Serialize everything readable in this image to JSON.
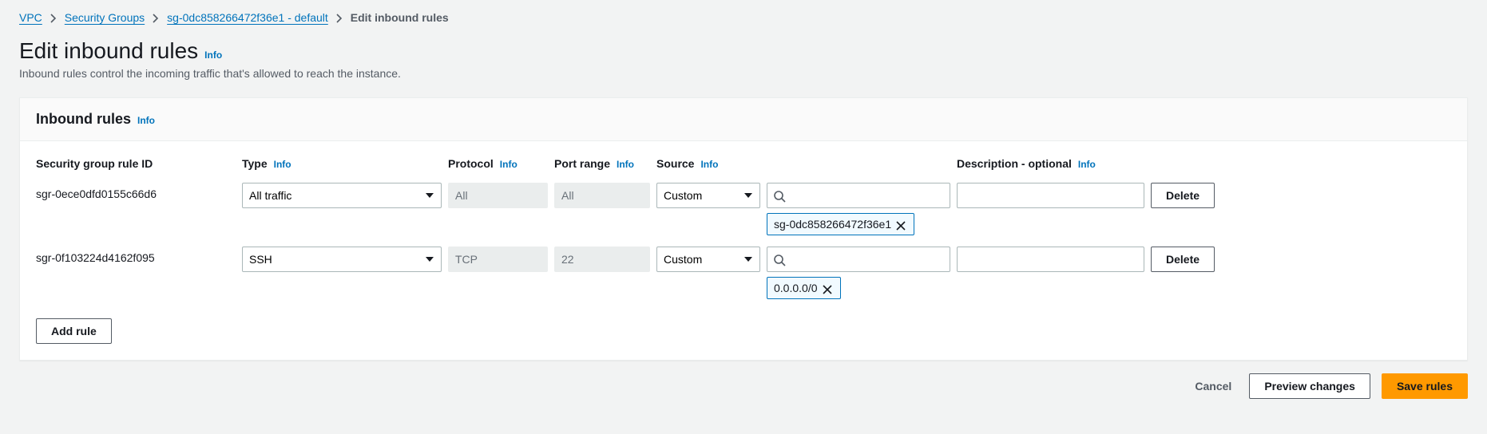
{
  "breadcrumb": {
    "items": [
      {
        "label": "VPC"
      },
      {
        "label": "Security Groups"
      },
      {
        "label": "sg-0dc858266472f36e1 - default"
      }
    ],
    "current": "Edit inbound rules"
  },
  "page": {
    "title": "Edit inbound rules",
    "info": "Info",
    "description": "Inbound rules control the incoming traffic that's allowed to reach the instance."
  },
  "panel": {
    "title": "Inbound rules",
    "info": "Info"
  },
  "columns": {
    "rule_id": "Security group rule ID",
    "type": "Type",
    "protocol": "Protocol",
    "port_range": "Port range",
    "source": "Source",
    "description": "Description - optional",
    "info": "Info"
  },
  "rules": [
    {
      "id": "sgr-0ece0dfd0155c66d6",
      "type": "All traffic",
      "protocol": "All",
      "port_range": "All",
      "source_mode": "Custom",
      "source_search": "",
      "source_tags": [
        "sg-0dc858266472f36e1"
      ],
      "description": ""
    },
    {
      "id": "sgr-0f103224d4162f095",
      "type": "SSH",
      "protocol": "TCP",
      "port_range": "22",
      "source_mode": "Custom",
      "source_search": "",
      "source_tags": [
        "0.0.0.0/0"
      ],
      "description": ""
    }
  ],
  "buttons": {
    "delete": "Delete",
    "add_rule": "Add rule",
    "cancel": "Cancel",
    "preview": "Preview changes",
    "save": "Save rules"
  }
}
